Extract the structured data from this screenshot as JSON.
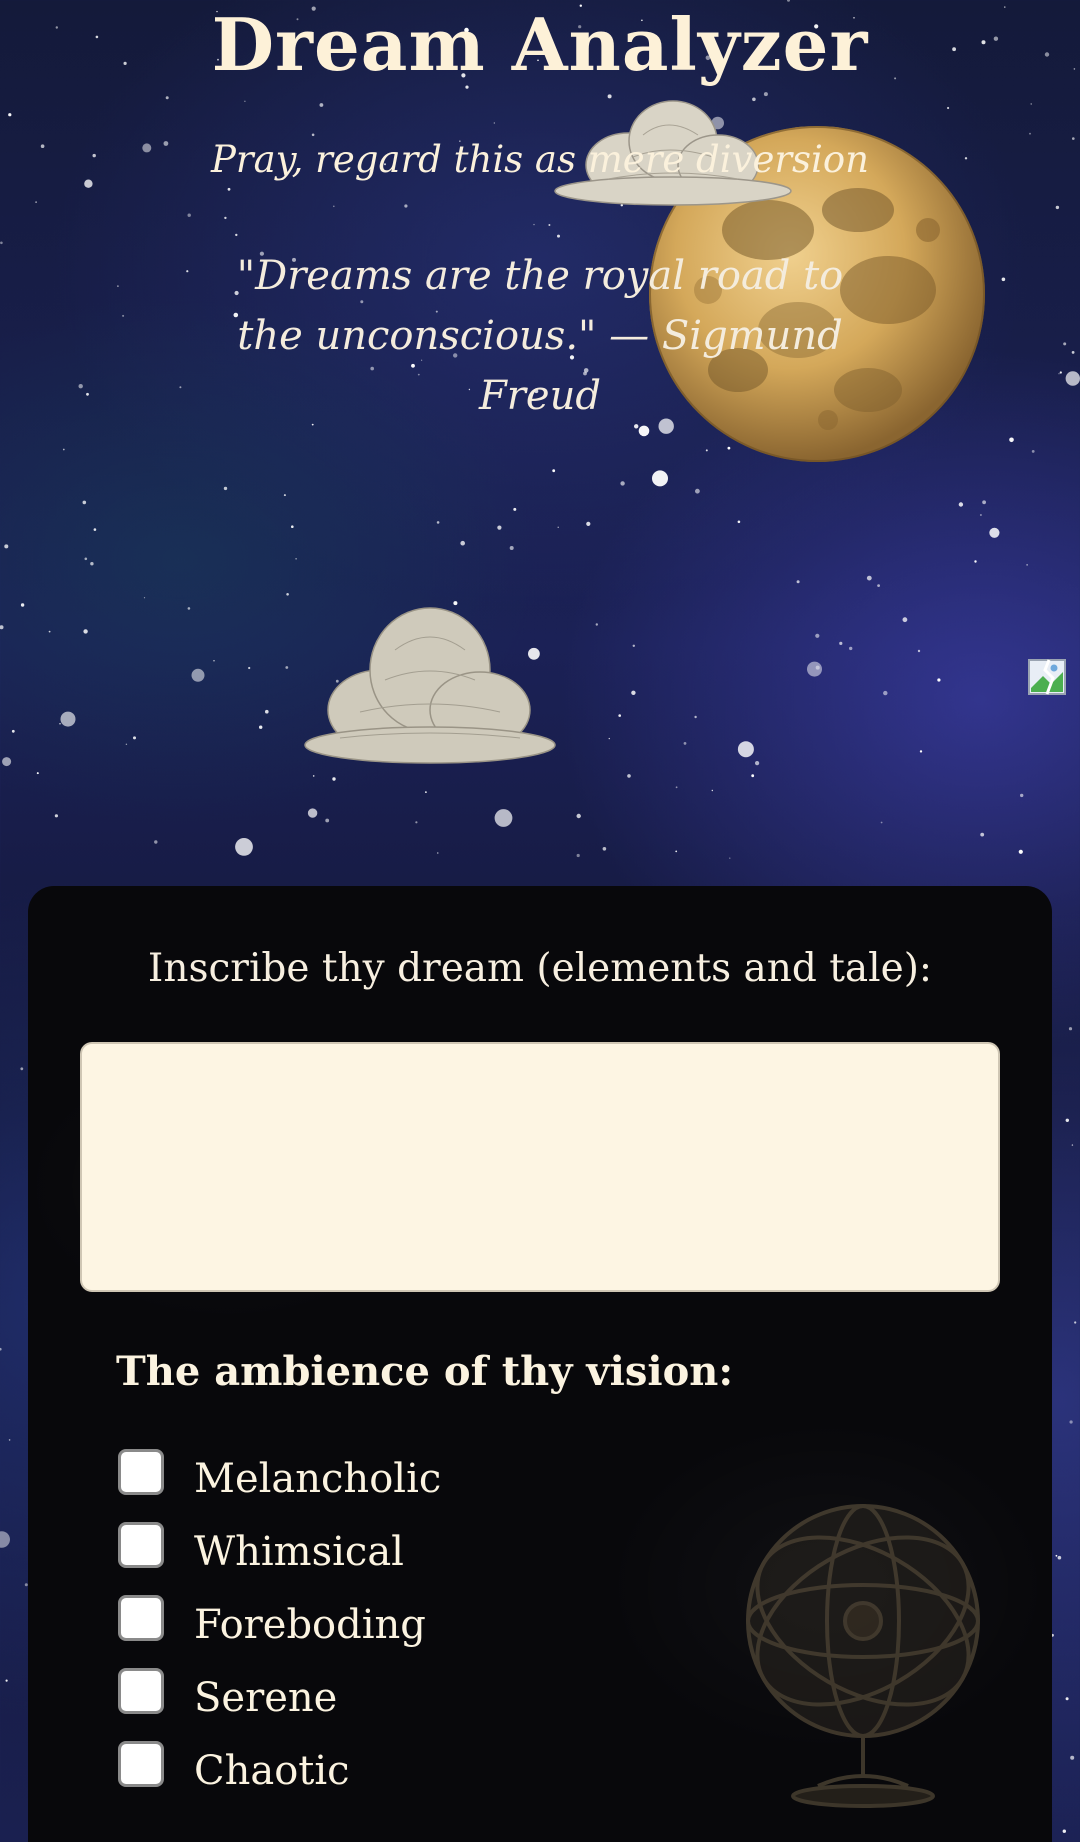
{
  "header": {
    "title": "Dream Analyzer",
    "subtitle": "Pray, regard this as mere diversion",
    "quote": "\"Dreams are the royal road to the unconscious.\" — Sigmund Freud"
  },
  "form": {
    "dream_label": "Inscribe thy dream (elements and tale):",
    "dream_value": "",
    "dream_placeholder": "",
    "ambience_heading": "The ambience of thy vision:",
    "moods": [
      {
        "label": "Melancholic",
        "checked": false
      },
      {
        "label": "Whimsical",
        "checked": false
      },
      {
        "label": "Foreboding",
        "checked": false
      },
      {
        "label": "Serene",
        "checked": false
      },
      {
        "label": "Chaotic",
        "checked": false
      }
    ]
  },
  "decor": {
    "icons": [
      "moon-icon",
      "cloud-icon",
      "cloud-icon",
      "broken-image-icon",
      "armillary-sphere-icon"
    ],
    "colors": {
      "sky": "#1b2156",
      "panel": "#08080b",
      "text": "#fbf3e0",
      "input_background": "#fdf5e3",
      "moon": "#d4a85a"
    }
  }
}
